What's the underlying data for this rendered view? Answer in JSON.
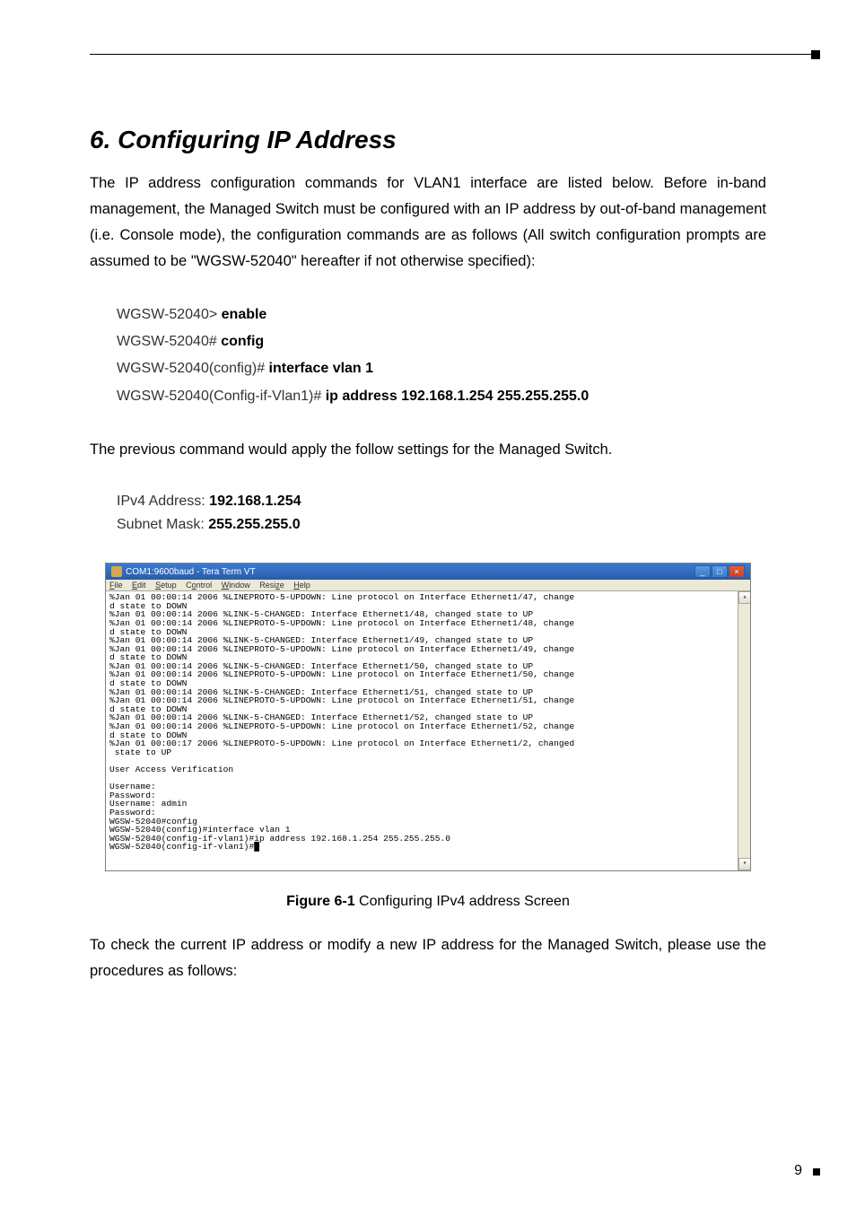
{
  "heading": "6. Configuring IP Address",
  "para1": "The IP address configuration commands for VLAN1 interface are listed below. Before in-band management, the Managed Switch must be configured with an IP address by out-of-band management (i.e. Console mode), the configuration commands are as follows (All switch configuration prompts are assumed to be \"WGSW-52040\" hereafter if not otherwise specified):",
  "code": {
    "line1_prompt": "WGSW-52040> ",
    "line1_cmd": "enable",
    "line2_prompt": "WGSW-52040# ",
    "line2_cmd": "config",
    "line3_prompt": "WGSW-52040(config)# ",
    "line3_cmd": "interface vlan 1",
    "line4_prompt": "WGSW-52040(Config-if-Vlan1)# ",
    "line4_cmd": "ip address 192.168.1.254 255.255.255.0"
  },
  "para2": "The previous command would apply the follow settings for the Managed Switch.",
  "settings": {
    "line1_label": "IPv4 Address: ",
    "line1_value": "192.168.1.254",
    "line2_label": "Subnet Mask: ",
    "line2_value": "255.255.255.0"
  },
  "terminal": {
    "title": "COM1:9600baud - Tera Term VT",
    "menu": {
      "file": "File",
      "edit": "Edit",
      "setup": "Setup",
      "control": "Control",
      "window": "Window",
      "resize": "Resize",
      "help": "Help"
    },
    "content": "%Jan 01 00:00:14 2006 %LINEPROTO-5-UPDOWN: Line protocol on Interface Ethernet1/47, change\nd state to DOWN\n%Jan 01 00:00:14 2006 %LINK-5-CHANGED: Interface Ethernet1/48, changed state to UP\n%Jan 01 00:00:14 2006 %LINEPROTO-5-UPDOWN: Line protocol on Interface Ethernet1/48, change\nd state to DOWN\n%Jan 01 00:00:14 2006 %LINK-5-CHANGED: Interface Ethernet1/49, changed state to UP\n%Jan 01 00:00:14 2006 %LINEPROTO-5-UPDOWN: Line protocol on Interface Ethernet1/49, change\nd state to DOWN\n%Jan 01 00:00:14 2006 %LINK-5-CHANGED: Interface Ethernet1/50, changed state to UP\n%Jan 01 00:00:14 2006 %LINEPROTO-5-UPDOWN: Line protocol on Interface Ethernet1/50, change\nd state to DOWN\n%Jan 01 00:00:14 2006 %LINK-5-CHANGED: Interface Ethernet1/51, changed state to UP\n%Jan 01 00:00:14 2006 %LINEPROTO-5-UPDOWN: Line protocol on Interface Ethernet1/51, change\nd state to DOWN\n%Jan 01 00:00:14 2006 %LINK-5-CHANGED: Interface Ethernet1/52, changed state to UP\n%Jan 01 00:00:14 2006 %LINEPROTO-5-UPDOWN: Line protocol on Interface Ethernet1/52, change\nd state to DOWN\n%Jan 01 00:00:17 2006 %LINEPROTO-5-UPDOWN: Line protocol on Interface Ethernet1/2, changed\n state to UP\n\nUser Access Verification\n\nUsername:\nPassword:\nUsername: admin\nPassword:\nWGSW-52040#config\nWGSW-52040(config)#interface vlan 1\nWGSW-52040(config-if-vlan1)#ip address 192.168.1.254 255.255.255.0\nWGSW-52040(config-if-vlan1)#█\n\n\n"
  },
  "figure_caption_label": "Figure 6-1",
  "figure_caption_text": "  Configuring IPv4 address Screen",
  "para3": "To check the current IP address or modify a new IP address for the Managed Switch, please use the procedures as follows:",
  "page_number": "9"
}
